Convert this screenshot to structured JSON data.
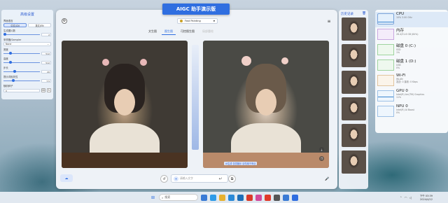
{
  "app": {
    "title": "AIGC 助手演示版"
  },
  "settings": {
    "title": "高级设置",
    "lang_label": "界面语言",
    "lang_options": [
      "中文(CN",
      "英文(EN"
    ],
    "steps_label": "生成图片数",
    "steps_value": "2",
    "sampler_label": "采样器/Sampler",
    "sampler_value": "None",
    "width_label": "宽度",
    "width_value": "512",
    "height_label": "高度",
    "height_value": "512",
    "cfg_label": "步长",
    "cfg_value": "20",
    "strength_label": "提示词相关性",
    "strength_value": "7.5",
    "seed_label": "随机种子",
    "seed_value": "0"
  },
  "toolbar": {
    "style_value": "Fast Painting",
    "tabs": [
      "文生图",
      "图生图",
      "可控图生图",
      "局部重绘"
    ]
  },
  "caption": "AI生成 仅供娱乐 请勿用于商业",
  "input": {
    "placeholder": "请输入文字"
  },
  "history": {
    "title": "历史记录"
  },
  "taskmanager": {
    "items": [
      {
        "name": "CPU",
        "sub": "10% 3.00 GHz"
      },
      {
        "name": "内存",
        "sub": "26.4/31.6 GB (84%)"
      },
      {
        "name": "磁盘 0 (C:)",
        "sub": "SSD\n1%"
      },
      {
        "name": "磁盘 1 (D:)",
        "sub": "USB\n0%"
      },
      {
        "name": "Wi-Fi",
        "sub": "WLAN\n发送: 0 接收: 0 Kbps"
      },
      {
        "name": "GPU 0",
        "sub": "Intel(R) Arc(TM) Graphics\n11%"
      },
      {
        "name": "NPU 0",
        "sub": "Intel(R) AI Boost\n0%"
      }
    ]
  },
  "taskbar": {
    "search_placeholder": "搜索",
    "time": "下午 03:39",
    "date": "2024/4/12"
  }
}
